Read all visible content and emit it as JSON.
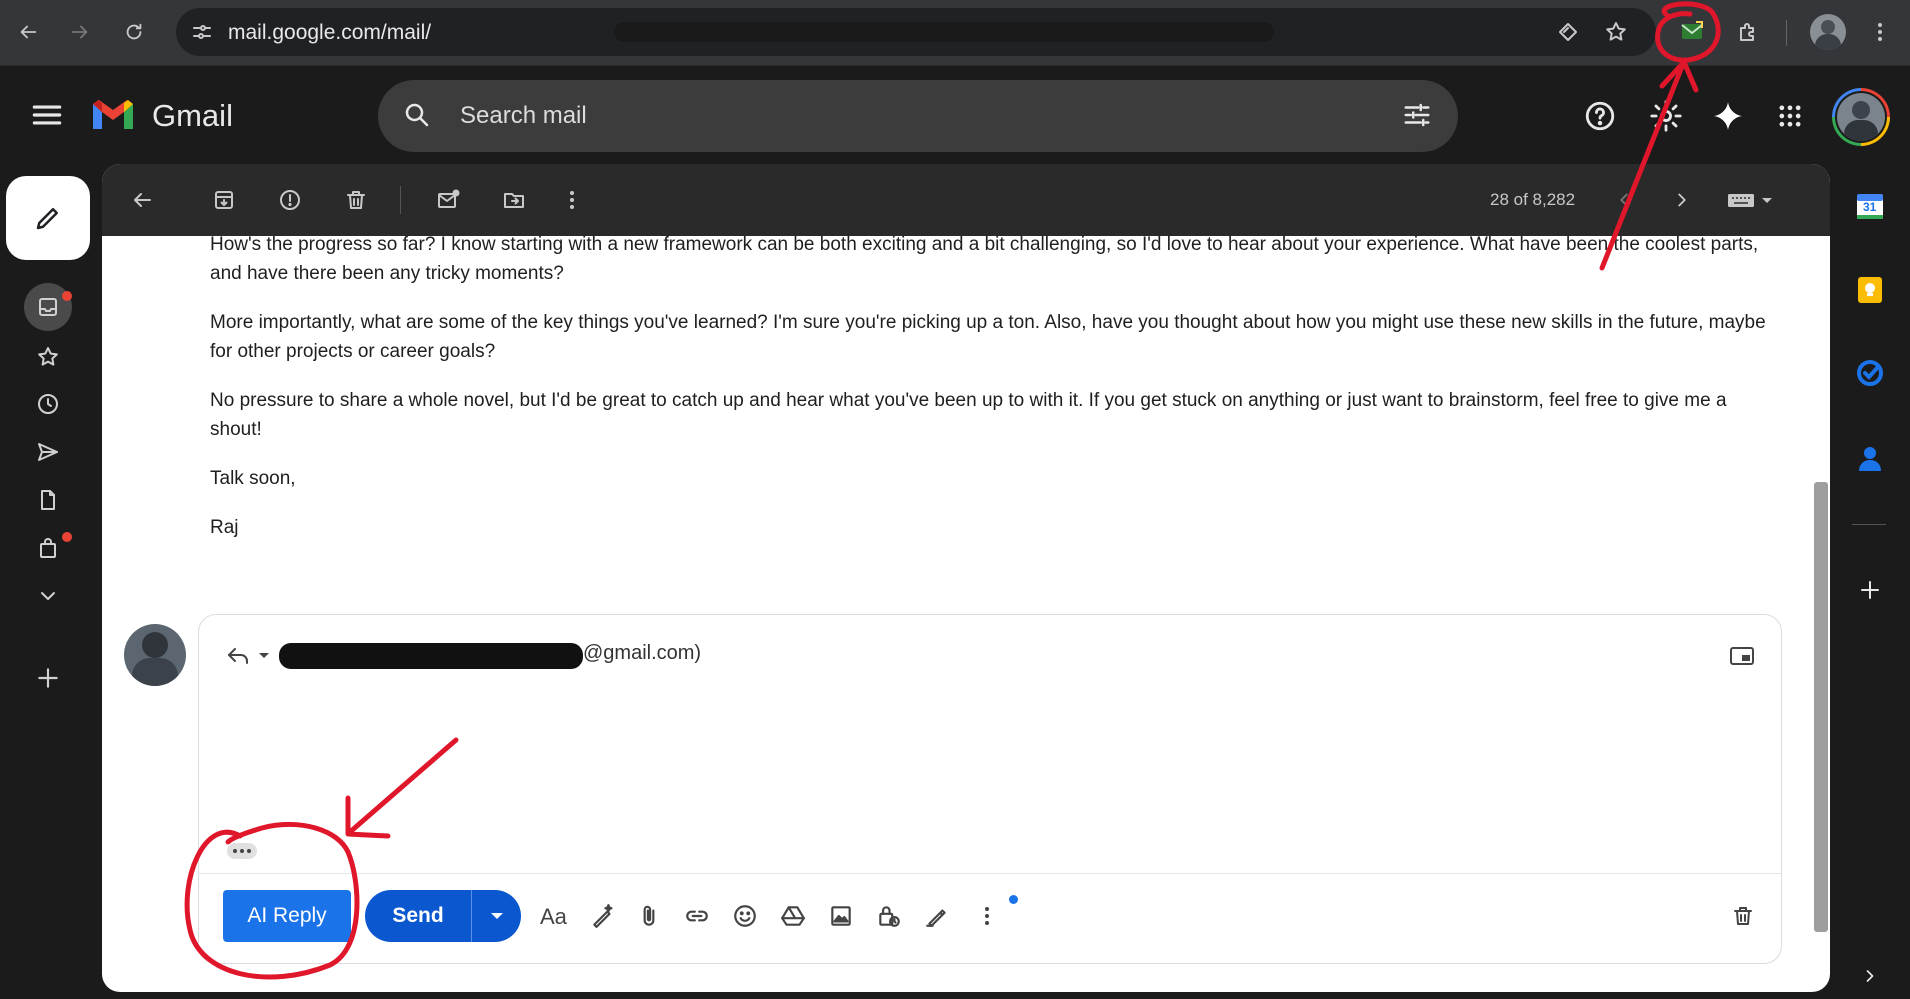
{
  "browser": {
    "url_text": "mail.google.com/mail/"
  },
  "gmail": {
    "logo_text": "Gmail",
    "search_placeholder": "Search mail"
  },
  "toolbar": {
    "page_count": "28 of 8,282"
  },
  "email": {
    "paragraphs": [
      "How's the progress so far? I know starting with a new framework can be both exciting and a bit challenging, so I'd love to hear about your experience. What have been the coolest parts, and have there been any tricky moments?",
      "More importantly, what are some of the key things you've learned? I'm sure you're picking up a ton. Also, have you thought about how you might use these new skills in the future, maybe for other projects or career goals?",
      "No pressure to share a whole novel, but I'd be great to catch up and hear what you've been up to with it. If you get stuck on anything or just want to brainstorm, feel free to give me a shout!",
      "Talk soon,",
      "Raj"
    ]
  },
  "reply": {
    "recipient_suffix": "@gmail.com)",
    "ai_reply_label": "AI Reply",
    "send_label": "Send"
  },
  "apps": {
    "calendar_day": "31"
  },
  "colors": {
    "annotation_red": "#e0162b",
    "send_blue": "#0b57d0",
    "ai_reply_blue": "#1a73e8"
  }
}
